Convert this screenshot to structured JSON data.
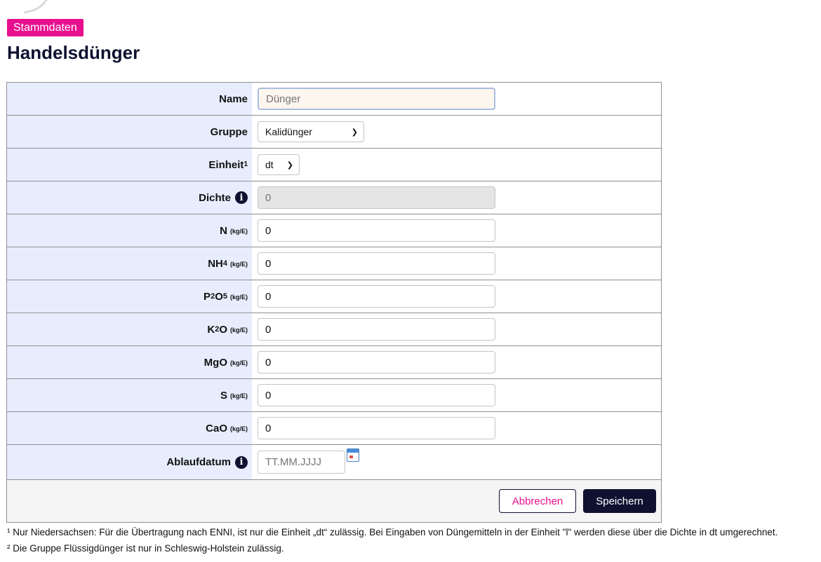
{
  "badge": "Stammdaten",
  "title": "Handelsdünger",
  "form": {
    "name": {
      "label": "Name",
      "placeholder": "Dünger"
    },
    "gruppe": {
      "label": "Gruppe",
      "value": "Kalidünger"
    },
    "einheit": {
      "label": "Einheit",
      "sup": "1",
      "value": "dt"
    },
    "dichte": {
      "label": "Dichte",
      "value": "0"
    },
    "n": {
      "label": "N",
      "unit": "(kg/E)",
      "value": "0"
    },
    "nh4": {
      "label": "NH",
      "sub": "4",
      "unit": "(kg/E)",
      "value": "0"
    },
    "p2o5": {
      "label_a": "P",
      "sub_a": "2",
      "label_b": "O",
      "sub_b": "5",
      "unit": "(kg/E)",
      "value": "0"
    },
    "k2o": {
      "label_a": "K",
      "sub_a": "2",
      "label_b": "O",
      "unit": "(kg/E)",
      "value": "0"
    },
    "mgo": {
      "label": "MgO",
      "unit": "(kg/E)",
      "value": "0"
    },
    "s": {
      "label": "S",
      "unit": "(kg/E)",
      "value": "0"
    },
    "cao": {
      "label": "CaO",
      "unit": "(kg/E)",
      "value": "0"
    },
    "ablaufdatum": {
      "label": "Ablaufdatum",
      "placeholder": "TT.MM.JJJJ"
    }
  },
  "buttons": {
    "cancel": "Abbrechen",
    "save": "Speichern"
  },
  "notes": [
    "¹ Nur Niedersachsen: Für die Übertragung nach ENNI, ist nur die Einheit „dt“ zulässig. Bei Eingaben von Düngemitteln in der Einheit \"l\" werden diese über die Dichte in dt umgerechnet.",
    "² Die Gruppe Flüssigdünger ist nur in Schleswig-Holstein zulässig."
  ],
  "icons": {
    "info": "info-icon",
    "calendar": "calendar-icon",
    "chevron": "chevron-down-icon"
  },
  "colors": {
    "accent": "#e8108e",
    "primary": "#0e1230",
    "label_bg": "#e7edfd"
  }
}
